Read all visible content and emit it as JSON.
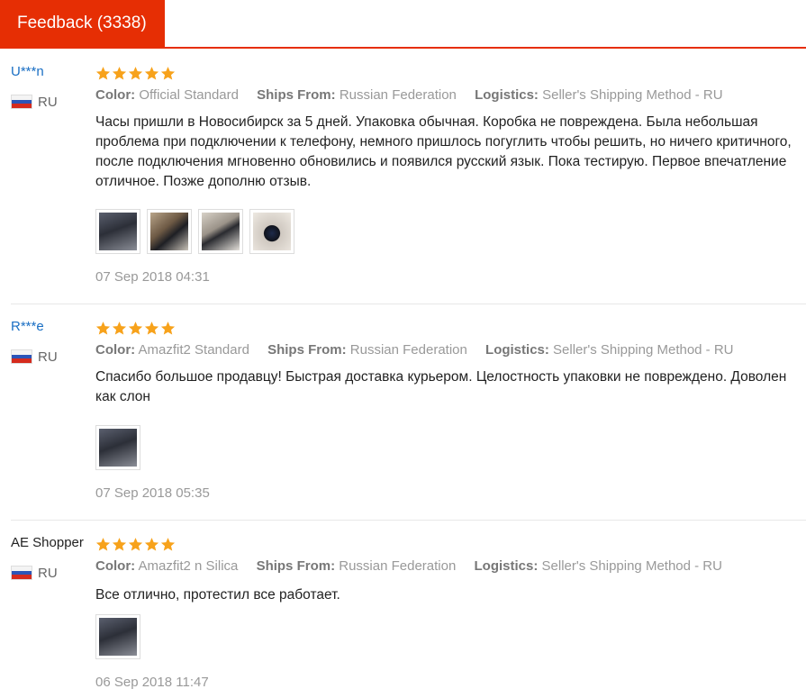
{
  "tabs": {
    "feedback_label": "Feedback (3338)"
  },
  "colors": {
    "accent": "#e62e04",
    "star": "#f7a21b",
    "user_link": "#1a6fc4"
  },
  "labels": {
    "color": "Color:",
    "ships_from": "Ships From:",
    "logistics": "Logistics:"
  },
  "reviews": [
    {
      "user": "U***n",
      "country": "RU",
      "stars": 5,
      "color": "Official Standard",
      "ships_from": "Russian Federation",
      "logistics": "Seller's Shipping Method - RU",
      "text": "Часы пришли в Новосибирск за 5 дней. Упаковка обычная. Коробка не повреждена. Была небольшая проблема при подключении к телефону, немного пришлось погуглить чтобы решить, но ничего критичного,  после подключения мгновенно обновились и появился русский язык. Пока тестирую. Первое впечатление отличное. Позже дополню отзыв.",
      "photos": [
        "watch-box-photo",
        "watch-in-box-photo",
        "watch-unboxing-photo",
        "watch-on-table-photo"
      ],
      "date": "07 Sep 2018 04:31"
    },
    {
      "user": "R***e",
      "country": "RU",
      "stars": 5,
      "color": "Amazfit2 Standard",
      "ships_from": "Russian Federation",
      "logistics": "Seller's Shipping Method - RU",
      "text": "Спасибо большое продавцу! Быстрая доставка курьером. Целостность упаковки не повреждено. Доволен как слон",
      "photos": [
        "watch-on-wrist-photo"
      ],
      "date": "07 Sep 2018 05:35"
    },
    {
      "user": "AE Shopper",
      "country": "RU",
      "stars": 5,
      "color": "Amazfit2 n Silica",
      "ships_from": "Russian Federation",
      "logistics": "Seller's Shipping Method - RU",
      "text": "Все отлично, протестил все работает.",
      "photos": [
        "watch-on-hand-photo"
      ],
      "date": "06 Sep 2018 11:47"
    }
  ]
}
